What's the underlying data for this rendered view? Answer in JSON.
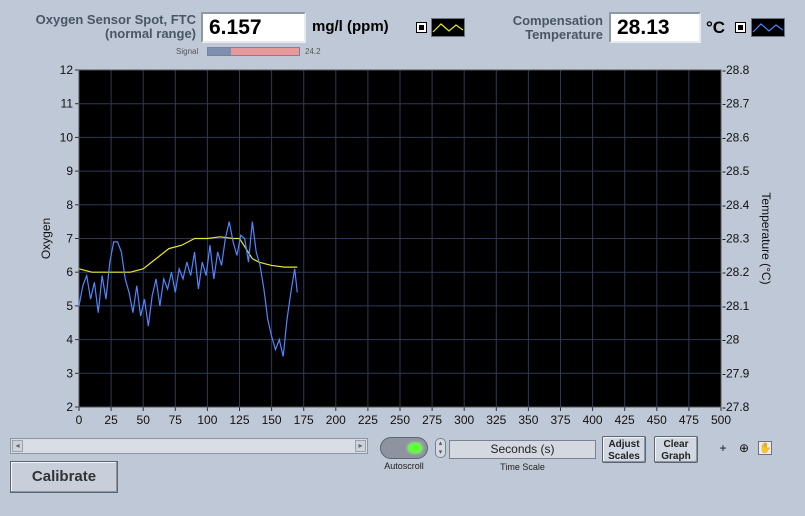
{
  "oxygen": {
    "label_line1": "Oxygen Sensor Spot, FTC",
    "label_line2": "(normal range)",
    "value": "6.157",
    "unit": "mg/l (ppm)",
    "signal_label": "Signal",
    "signal_value": "24.2",
    "signal_fraction": 0.25
  },
  "temperature": {
    "label_line1": "Compensation",
    "label_line2": "Temperature",
    "value": "28.13",
    "unit": "°C"
  },
  "colors": {
    "oxygen_series": "#4d87ff",
    "temperature_series": "#e8e830",
    "plot_bg": "#000000",
    "grid": "#2e3a55",
    "signal_bar": "#e89a9a",
    "led_on": "#5cff3a"
  },
  "chart_data": {
    "type": "line",
    "xlim": [
      0,
      500
    ],
    "xticks": [
      0,
      25,
      50,
      75,
      100,
      125,
      150,
      175,
      200,
      225,
      250,
      275,
      300,
      325,
      350,
      375,
      400,
      425,
      450,
      475,
      500
    ],
    "ylim": [
      2,
      12
    ],
    "yticks": [
      2,
      3,
      4,
      5,
      6,
      7,
      8,
      9,
      10,
      11,
      12
    ],
    "ylabel": "Oxygen",
    "y2lim": [
      27.8,
      28.8
    ],
    "y2ticks": [
      "-27.8",
      "-27.9",
      "-28",
      "-28.1",
      "-28.2",
      "-28.3",
      "-28.4",
      "-28.5",
      "-28.6",
      "-28.7",
      "-28.8"
    ],
    "y2label": "Temperature (°C)",
    "grid": true,
    "series": [
      {
        "axis": "left",
        "x": [
          0,
          3,
          6,
          9,
          12,
          15,
          18,
          21,
          24,
          27,
          30,
          33,
          36,
          39,
          42,
          45,
          48,
          51,
          54,
          57,
          60,
          63,
          66,
          69,
          72,
          75,
          78,
          81,
          84,
          87,
          90,
          93,
          96,
          99,
          102,
          105,
          108,
          111,
          114,
          117,
          120,
          123,
          126,
          129,
          132,
          135,
          138,
          141,
          144,
          147,
          150,
          153,
          156,
          159,
          162,
          165,
          168,
          170
        ],
        "y": [
          5.0,
          5.6,
          5.9,
          5.2,
          5.7,
          4.8,
          5.9,
          5.2,
          6.3,
          6.9,
          6.9,
          6.6,
          5.8,
          5.4,
          4.8,
          5.6,
          4.7,
          5.2,
          4.4,
          5.3,
          5.8,
          5.0,
          5.8,
          5.5,
          6.0,
          5.4,
          6.1,
          5.8,
          6.3,
          5.9,
          6.6,
          5.5,
          6.3,
          5.9,
          6.8,
          5.8,
          6.6,
          6.2,
          7.0,
          7.5,
          6.9,
          6.5,
          7.1,
          7.0,
          6.3,
          7.5,
          6.6,
          6.2,
          5.5,
          4.6,
          4.1,
          3.7,
          4.0,
          3.5,
          4.6,
          5.4,
          6.1,
          5.4
        ]
      },
      {
        "axis": "right",
        "x": [
          0,
          10,
          20,
          30,
          40,
          50,
          60,
          70,
          80,
          90,
          100,
          110,
          120,
          125,
          130,
          135,
          140,
          145,
          150,
          160,
          170
        ],
        "y": [
          28.21,
          28.2,
          28.2,
          28.2,
          28.2,
          28.21,
          28.24,
          28.27,
          28.28,
          28.3,
          28.3,
          28.305,
          28.3,
          28.3,
          28.27,
          28.24,
          28.23,
          28.225,
          28.22,
          28.215,
          28.215
        ]
      }
    ]
  },
  "controls": {
    "autoscroll_label": "Autoscroll",
    "time_scale_value": "Seconds (s)",
    "time_scale_label": "Time Scale",
    "adjust_scales_line1": "Adjust",
    "adjust_scales_line2": "Scales",
    "clear_graph_line1": "Clear",
    "clear_graph_line2": "Graph",
    "calibrate_label": "Calibrate",
    "scroll_left": "◂",
    "scroll_right": "▸",
    "spin_up": "▴",
    "spin_down": "▾",
    "tool_cursor": "+",
    "tool_zoom": "⊕",
    "tool_pan": "✋"
  }
}
